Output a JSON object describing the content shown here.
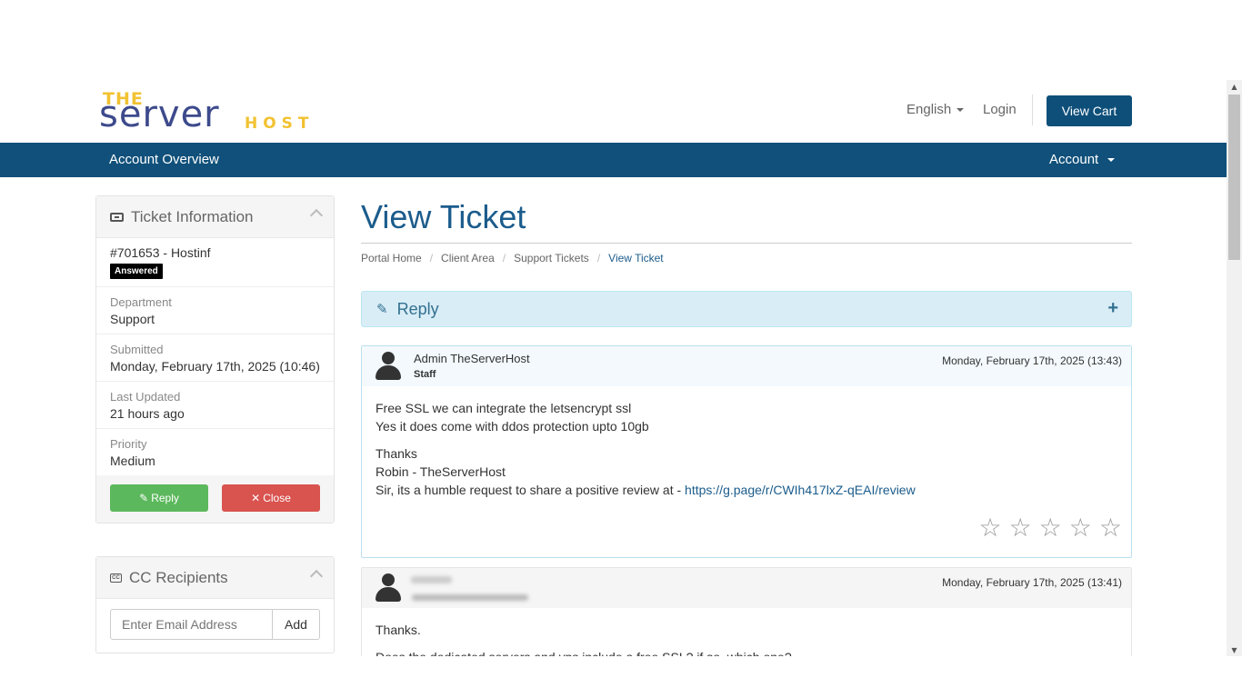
{
  "header": {
    "logo_the": "THE",
    "logo_server": "server",
    "logo_host": "HOST",
    "language": "English",
    "login": "Login",
    "view_cart": "View Cart"
  },
  "nav": {
    "account_overview": "Account Overview",
    "account": "Account"
  },
  "sidebar": {
    "ticket_info": {
      "title": "Ticket Information",
      "ticket_id": "#701653 - Hostinf",
      "status": "Answered",
      "department_label": "Department",
      "department": "Support",
      "submitted_label": "Submitted",
      "submitted": "Monday, February 17th, 2025 (10:46)",
      "last_updated_label": "Last Updated",
      "last_updated": "21 hours ago",
      "priority_label": "Priority",
      "priority": "Medium",
      "reply_button": "Reply",
      "close_button": "Close"
    },
    "cc": {
      "title": "CC Recipients",
      "email_placeholder": "Enter Email Address",
      "add_button": "Add",
      "icon_text": "CC"
    }
  },
  "main": {
    "title": "View Ticket",
    "breadcrumb": [
      "Portal Home",
      "Client Area",
      "Support Tickets",
      "View Ticket"
    ],
    "reply_bar": {
      "label": "Reply",
      "toggle": "+"
    },
    "messages": [
      {
        "poster": "Admin TheServerHost",
        "role": "Staff",
        "date": "Monday, February 17th, 2025 (13:43)",
        "lines1": [
          "Free SSL we can integrate the letsencrypt ssl",
          "Yes it does come with ddos protection upto 10gb"
        ],
        "lines2": [
          "Thanks",
          "Robin - TheServerHost"
        ],
        "review_prefix": "Sir, its a humble request to share a positive review at - ",
        "review_link": "https://g.page/r/CWIh417lxZ-qEAI/review",
        "rating": 0,
        "rating_max": 5
      },
      {
        "date": "Monday, February 17th, 2025 (13:41)",
        "line1": "Thanks.",
        "line2": "Does the dedicated servers and vps include a free SSL? if so, which one?"
      }
    ]
  },
  "colors": {
    "brand_blue": "#10507a",
    "title_blue": "#1b5c8c",
    "logo_yellow": "#f1c232",
    "logo_navy": "#3d4a8c",
    "reply_green": "#5cb85c",
    "close_red": "#d9534f"
  }
}
